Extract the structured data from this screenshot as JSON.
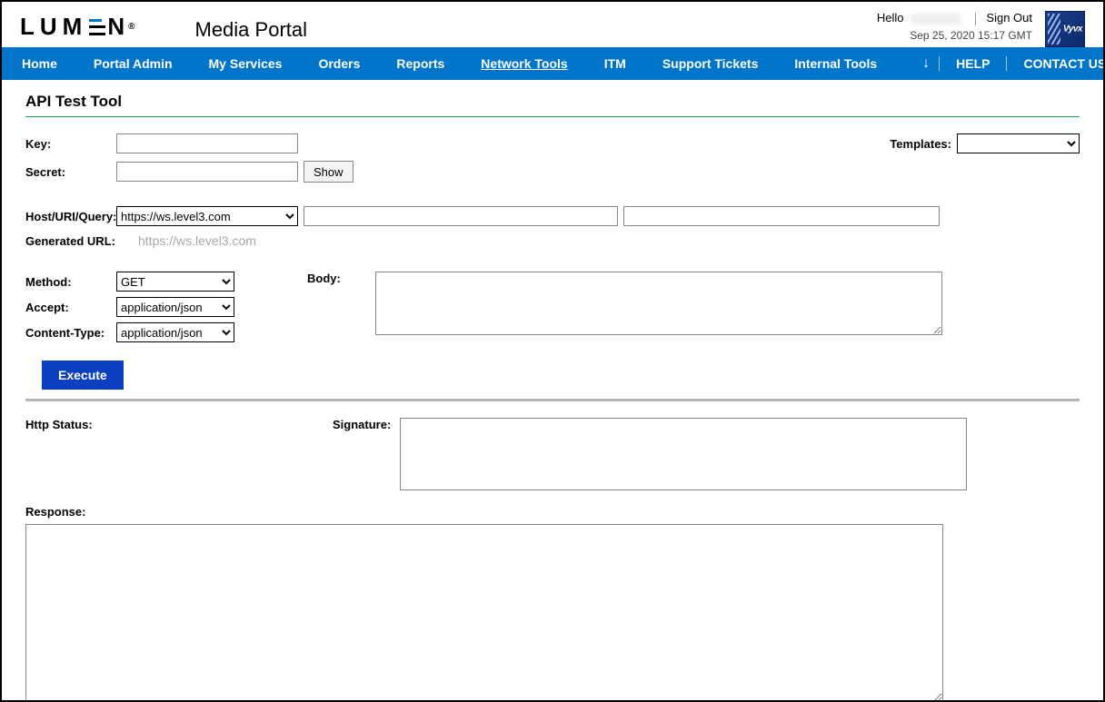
{
  "header": {
    "logo_text_parts": [
      "L",
      "U",
      "M",
      "E",
      "N"
    ],
    "portal_title": "Media Portal",
    "greeting": "Hello",
    "sign_out": "Sign Out",
    "timestamp": "Sep 25, 2020 15:17 GMT",
    "vyvx_label": "Vyvx"
  },
  "nav": {
    "items": [
      {
        "label": "Home",
        "active": false
      },
      {
        "label": "Portal Admin",
        "active": false
      },
      {
        "label": "My Services",
        "active": false
      },
      {
        "label": "Orders",
        "active": false
      },
      {
        "label": "Reports",
        "active": false
      },
      {
        "label": "Network Tools",
        "active": true
      },
      {
        "label": "ITM",
        "active": false
      },
      {
        "label": "Support Tickets",
        "active": false
      },
      {
        "label": "Internal Tools",
        "active": false
      }
    ],
    "help": "HELP",
    "contact": "CONTACT US"
  },
  "page": {
    "title": "API Test Tool",
    "labels": {
      "key": "Key:",
      "secret": "Secret:",
      "show_btn": "Show",
      "templates": "Templates:",
      "host": "Host/URI/Query:",
      "gen_url": "Generated URL:",
      "method": "Method:",
      "accept": "Accept:",
      "content_type": "Content-Type:",
      "body": "Body:",
      "execute": "Execute",
      "http_status": "Http Status:",
      "signature": "Signature:",
      "response": "Response:"
    },
    "values": {
      "key": "",
      "secret": "",
      "templates_options": [
        ""
      ],
      "templates_selected": "",
      "host_options": [
        "https://ws.level3.com"
      ],
      "host_selected": "https://ws.level3.com",
      "uri": "",
      "query": "",
      "generated_url": "https://ws.level3.com",
      "method_options": [
        "GET"
      ],
      "method_selected": "GET",
      "accept_options": [
        "application/json"
      ],
      "accept_selected": "application/json",
      "content_type_options": [
        "application/json"
      ],
      "content_type_selected": "application/json",
      "body": "",
      "http_status": "",
      "signature": "",
      "response": ""
    }
  }
}
